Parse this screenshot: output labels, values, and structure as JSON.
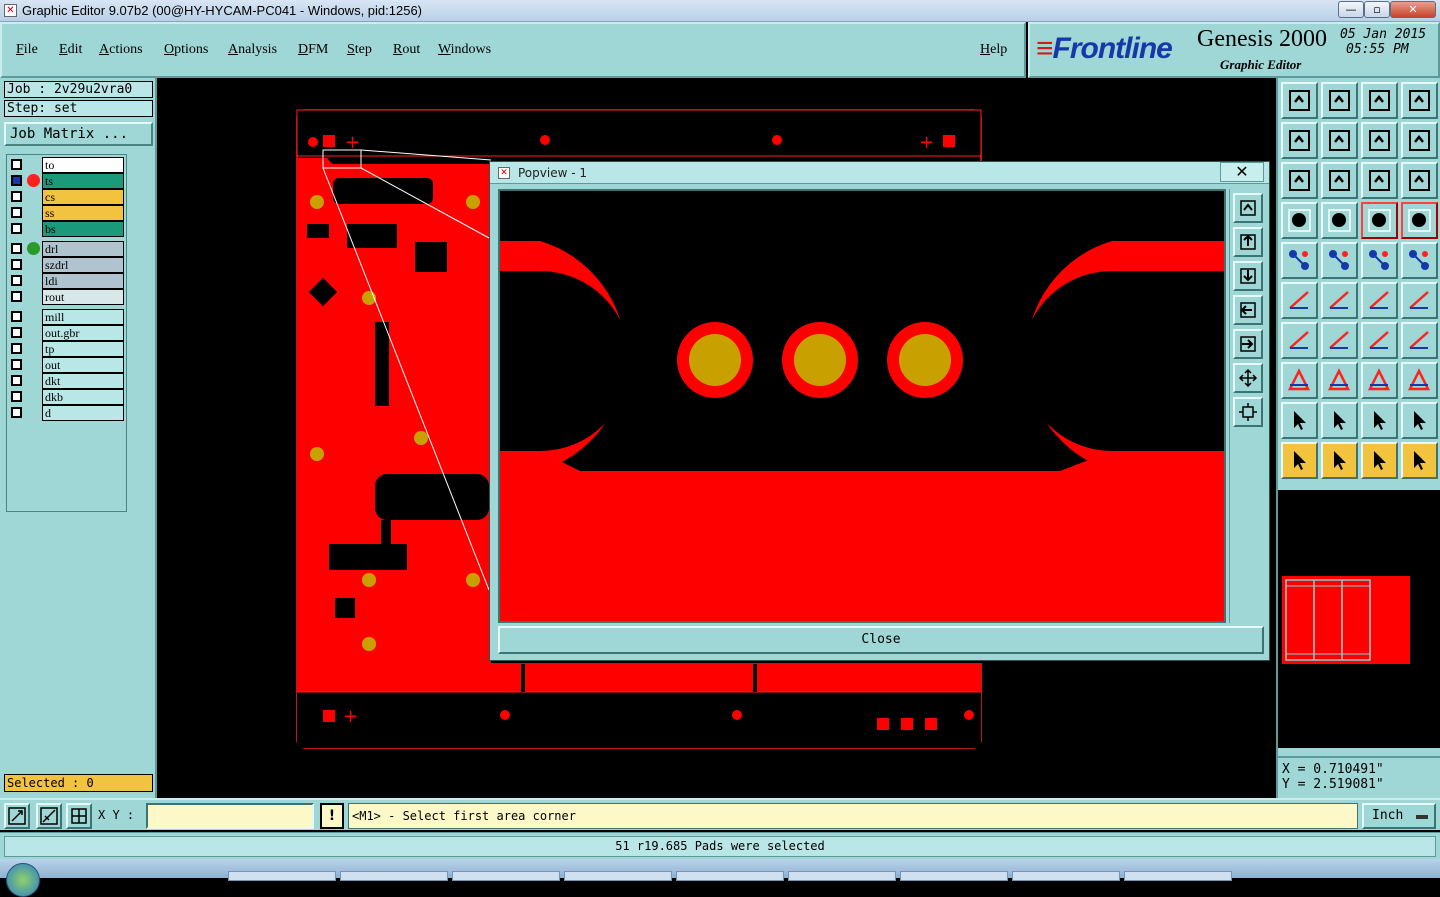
{
  "window": {
    "title": "Graphic Editor 9.07b2 (00@HY-HYCAM-PC041 - Windows, pid:1256)",
    "min_glyph": "—",
    "max_glyph": "▫",
    "close_glyph": "✕"
  },
  "menu": {
    "items": [
      "File",
      "Edit",
      "Actions",
      "Options",
      "Analysis",
      "DFM",
      "Step",
      "Rout",
      "Windows"
    ],
    "help": "Help"
  },
  "branding": {
    "logo": "Frontline",
    "product": "Genesis 2000",
    "subtitle": "Graphic Editor",
    "date": "05 Jan 2015",
    "time": "05:55 PM"
  },
  "left": {
    "job": "Job : 2v29u2vra0",
    "step": "Step: set",
    "job_matrix": "Job Matrix ...",
    "layers": [
      {
        "name": "to",
        "color": "#ffffff",
        "dot": ""
      },
      {
        "name": "ts",
        "color": "#1a9a7a",
        "dot": "#ff2020",
        "active": true
      },
      {
        "name": "cs",
        "color": "#f2c33e",
        "dot": ""
      },
      {
        "name": "ss",
        "color": "#f2c33e",
        "dot": ""
      },
      {
        "name": "bs",
        "color": "#1a9a7a",
        "dot": ""
      },
      {
        "name": "drl",
        "color": "#b0c4d0",
        "dot": "#2a9a2a"
      },
      {
        "name": "szdrl",
        "color": "#b0c4d0",
        "dot": ""
      },
      {
        "name": "ldi",
        "color": "#b0c4d0",
        "dot": ""
      },
      {
        "name": "rout",
        "color": "#d8e8e8",
        "dot": ""
      },
      {
        "name": "mill",
        "color": "#b9e6e6",
        "dot": ""
      },
      {
        "name": "out.gbr",
        "color": "#b9e6e6",
        "dot": ""
      },
      {
        "name": "tp",
        "color": "#b9e6e6",
        "dot": ""
      },
      {
        "name": "out",
        "color": "#b9e6e6",
        "dot": ""
      },
      {
        "name": "dkt",
        "color": "#b9e6e6",
        "dot": ""
      },
      {
        "name": "dkb",
        "color": "#b9e6e6",
        "dot": ""
      },
      {
        "name": "d",
        "color": "#b9e6e6",
        "dot": ""
      }
    ],
    "selected": "Selected : 0"
  },
  "popview": {
    "title": "Popview - 1",
    "close_x": "✕",
    "close_button": "Close"
  },
  "coords": {
    "x": "X = 0.710491\"",
    "y": "Y = 2.519081\""
  },
  "bottom": {
    "xy_label": "X Y :",
    "xy_value": "",
    "warn": "!",
    "prompt": "<M1> - Select first area corner",
    "unit": "Inch",
    "status": "51 r19.685 Pads were selected"
  },
  "colors": {
    "panel": "#9fd6d6",
    "copper": "#ff0000",
    "pad": "#c8a000",
    "canvas": "#000000"
  }
}
